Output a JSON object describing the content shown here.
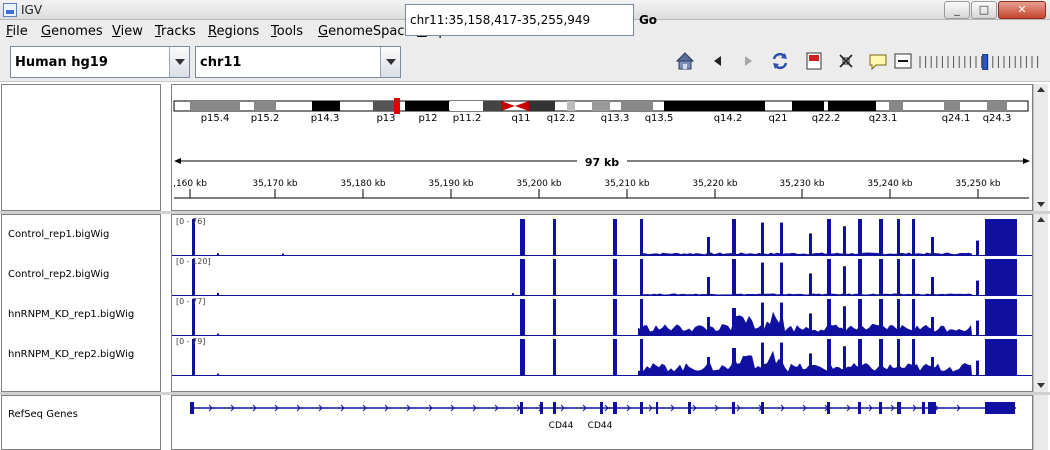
{
  "window": {
    "title": "IGV",
    "minimize": "_",
    "maximize": "□",
    "close": "✕"
  },
  "menu": [
    "File",
    "Genomes",
    "View",
    "Tracks",
    "Regions",
    "Tools",
    "GenomeSpace",
    "Help"
  ],
  "toolbar": {
    "genome": "Human hg19",
    "chromosome": "chr11",
    "locus": "chr11:35,158,417-35,255,949",
    "go_label": "Go",
    "icons": [
      "home-icon",
      "back-icon",
      "forward-icon",
      "refresh-icon",
      "region-of-interest-icon",
      "resize-icon",
      "popup-text-icon",
      "zoom-out-icon"
    ],
    "zoom_level": 0.55
  },
  "ideogram": {
    "bands": [
      "p15.4",
      "p15.2",
      "p14.3",
      "p13",
      "p12",
      "p11.2",
      "q11",
      "q12.2",
      "q13.3",
      "q13.5",
      "q14.2",
      "q21",
      "q22.2",
      "q23.1",
      "q24.1",
      "q24.3"
    ],
    "highlight_color": "#e00000"
  },
  "ruler": {
    "span": "97 kb",
    "ticks": [
      ",160 kb",
      "35,170 kb",
      "35,180 kb",
      "35,190 kb",
      "35,200 kb",
      "35,210 kb",
      "35,220 kb",
      "35,230 kb",
      "35,240 kb",
      "35,250 kb"
    ]
  },
  "tracks": [
    {
      "name": "Control_rep1.bigWig",
      "range": "[0 - 76]"
    },
    {
      "name": "Control_rep2.bigWig",
      "range": "[0 - 120]"
    },
    {
      "name": "hnRNPM_KD_rep1.bigWig",
      "range": "[0 - 77]"
    },
    {
      "name": "hnRNPM_KD_rep2.bigWig",
      "range": "[0 - 79]"
    }
  ],
  "track_color": "#1010a0",
  "genes": {
    "track_name": "RefSeq Genes",
    "labels": [
      "CD44",
      "CD44"
    ]
  }
}
